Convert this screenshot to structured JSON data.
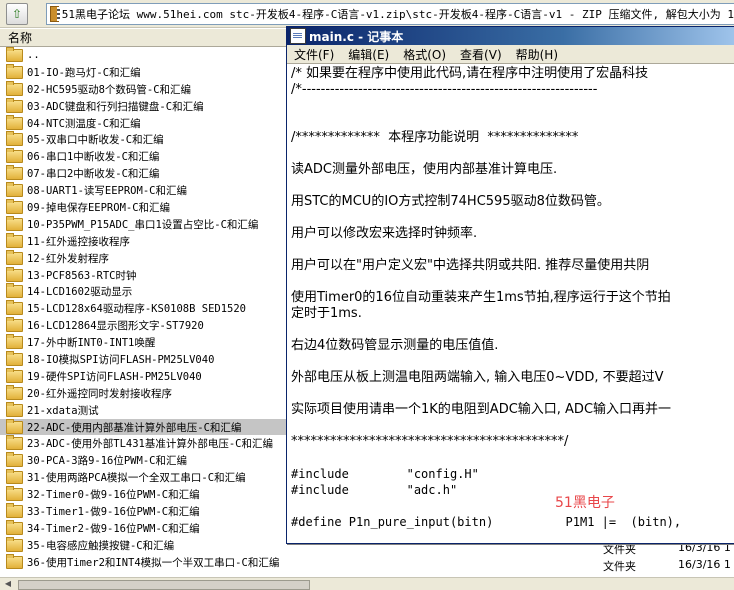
{
  "path_bar": {
    "path": "51黑电子论坛 www.51hei.com stc-开发板4-程序-C语言-v1.zip\\stc-开发板4-程序-C语言-v1 - ZIP 压缩文件, 解包大小为 1"
  },
  "file_list": {
    "column_name": "名称",
    "items": [
      {
        "name": ".."
      },
      {
        "name": "01-IO-跑马灯-C和汇编"
      },
      {
        "name": "02-HC595驱动8个数码管-C和汇编"
      },
      {
        "name": "03-ADC键盘和行列扫描键盘-C和汇编"
      },
      {
        "name": "04-NTC测温度-C和汇编"
      },
      {
        "name": "05-双串口中断收发-C和汇编"
      },
      {
        "name": "06-串口1中断收发-C和汇编"
      },
      {
        "name": "07-串口2中断收发-C和汇编"
      },
      {
        "name": "08-UART1-读写EEPROM-C和汇编"
      },
      {
        "name": "09-掉电保存EEPROM-C和汇编"
      },
      {
        "name": "10-P35PWM_P15ADC_串口1设置占空比-C和汇编"
      },
      {
        "name": "11-红外遥控接收程序"
      },
      {
        "name": "12-红外发射程序"
      },
      {
        "name": "13-PCF8563-RTC时钟"
      },
      {
        "name": "14-LCD1602驱动显示"
      },
      {
        "name": "15-LCD128x64驱动程序-KS0108B SED1520"
      },
      {
        "name": "16-LCD12864显示图形文字-ST7920"
      },
      {
        "name": "17-外中断INT0-INT1唤醒"
      },
      {
        "name": "18-IO模拟SPI访问FLASH-PM25LV040"
      },
      {
        "name": "19-硬件SPI访问FLASH-PM25LV040"
      },
      {
        "name": "20-红外遥控同时发射接收程序"
      },
      {
        "name": "21-xdata测试"
      },
      {
        "name": "22-ADC-使用内部基准计算外部电压-C和汇编",
        "selected": true
      },
      {
        "name": "23-ADC-使用外部TL431基准计算外部电压-C和汇编"
      },
      {
        "name": "30-PCA-3路9-16位PWM-C和汇编"
      },
      {
        "name": "31-使用两路PCA模拟一个全双工串口-C和汇编"
      },
      {
        "name": "32-Timer0-做9-16位PWM-C和汇编"
      },
      {
        "name": "33-Timer1-做9-16位PWM-C和汇编"
      },
      {
        "name": "34-Timer2-做9-16位PWM-C和汇编"
      },
      {
        "name": "35-电容感应触摸按键-C和汇编"
      },
      {
        "name": "36-使用Timer2和INT4模拟一个半双工串口-C和汇编"
      }
    ],
    "extra_rows": [
      {
        "type": "文件夹",
        "date": "16/3/16 1"
      },
      {
        "type": "文件夹",
        "date": "16/3/16 1"
      }
    ]
  },
  "notepad": {
    "title": "main.c - 记事本",
    "menu": [
      "文件(F)",
      "编辑(E)",
      "格式(O)",
      "查看(V)",
      "帮助(H)"
    ],
    "lines": [
      "/* 如果要在程序中使用此代码,请在程序中注明使用了宏晶科技",
      "/*---------------------------------------------------------------",
      "",
      "",
      "/*************  本程序功能说明  **************",
      "",
      "读ADC测量外部电压，使用内部基准计算电压.",
      "",
      "用STC的MCU的IO方式控制74HC595驱动8位数码管。",
      "",
      "用户可以修改宏来选择时钟频率.",
      "",
      "用户可以在\"用户定义宏\"中选择共阴或共阳. 推荐尽量使用共阴",
      "",
      "使用Timer0的16位自动重装来产生1ms节拍,程序运行于这个节拍",
      "定时于1ms.",
      "",
      "右边4位数码管显示测量的电压值值.",
      "",
      "外部电压从板上测温电阻两端输入, 输入电压0~VDD, 不要超过V",
      "",
      "实际项目使用请串一个1K的电阻到ADC输入口, ADC输入口再并一",
      "",
      "******************************************/",
      "",
      "#include        \"config.H\"",
      "#include        \"adc.h\"",
      "",
      "#define P1n_pure_input(bitn)          P1M1 |=  (bitn),"
    ],
    "watermark": "51黑电子"
  }
}
